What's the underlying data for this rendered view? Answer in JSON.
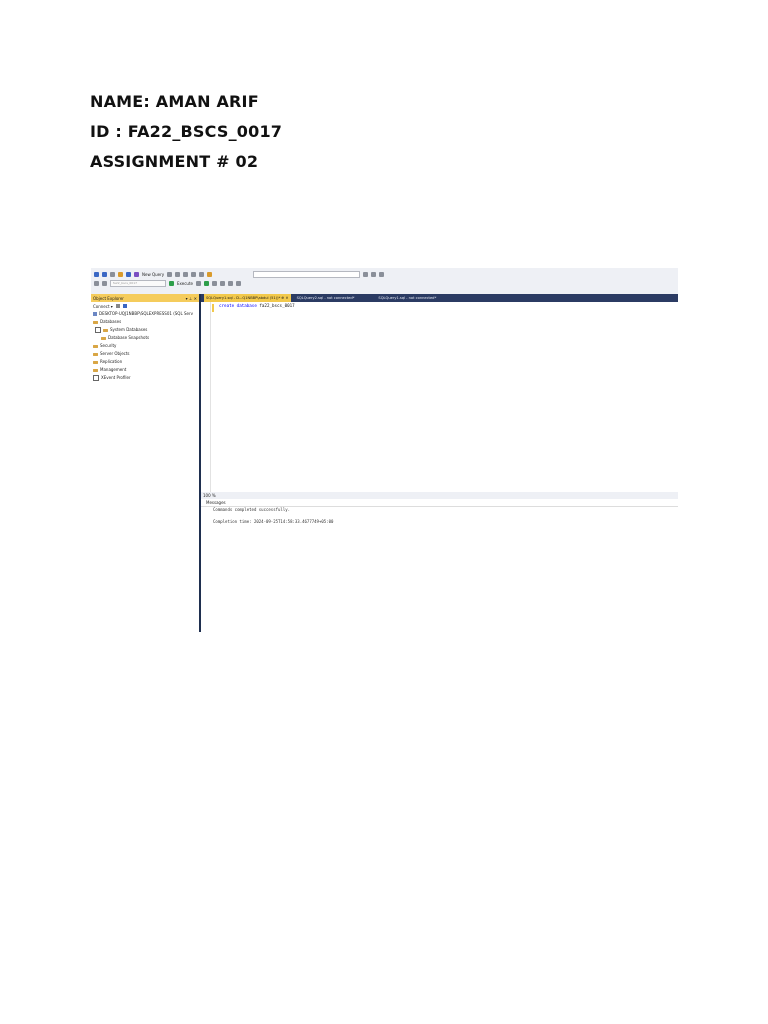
{
  "header": {
    "name": "NAME: AMAN ARIF",
    "id": "ID : FA22_BSCS_0017",
    "assignment": "ASSIGNMENT # 02"
  },
  "ssms": {
    "toolbar": {
      "new_query_label": "New Query",
      "execute_label": "Execute",
      "database_selector": "fa22_bscs_0017"
    },
    "object_explorer": {
      "title": "Object Explorer",
      "title_controls": "▾ ⊥ ✕",
      "connect_label": "Connect ▾",
      "server": "DESKTOP-UQJ1NBBP\\SQLEXPRESS01 (SQL Serv",
      "tree": [
        "Databases",
        "System Databases",
        "Database Snapshots",
        "Security",
        "Server Objects",
        "Replication",
        "Management",
        "XEvent Profiler"
      ]
    },
    "tabs": [
      "SQLQuery1.sql - D...Q1NBBP\\abdul (51))* ⊕ ✕",
      "SQLQuery2.sql - not connected*",
      "SQLQuery1.sql - not connected*"
    ],
    "editor": {
      "keyword1": "create",
      "keyword2": "database",
      "identifier": "fa22_bscs_0017"
    },
    "zoom_label": "100 %",
    "messages_tab": "Messages",
    "messages": [
      "Commands completed successfully.",
      "Completion time: 2024-09-25T14:58:33.4677749+05:00"
    ]
  }
}
